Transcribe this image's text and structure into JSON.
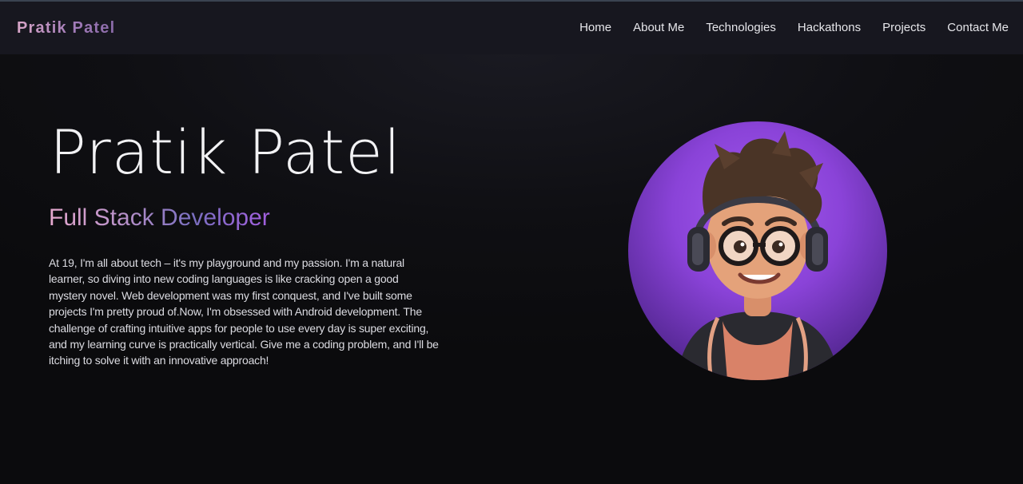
{
  "navbar": {
    "brand": "Pratik Patel",
    "links": [
      "Home",
      "About Me",
      "Technologies",
      "Hackathons",
      "Projects",
      "Contact Me"
    ]
  },
  "hero": {
    "name": "Pratik Patel",
    "role": "Full Stack Developer",
    "bio": "At 19, I'm all about tech – it's my playground and my passion. I'm a natural learner, so diving into new coding languages is like cracking open a good mystery novel. Web development was my first conquest, and I've built some projects I'm pretty proud of.Now, I'm obsessed with Android development. The challenge of crafting intuitive apps for people to use every day is super exciting, and my learning curve is practically vertical. Give me a coding problem, and I'll be itching to solve it with an innovative approach!",
    "avatar_icon": "cartoon-avatar-with-headphones"
  },
  "colors": {
    "background": "#0c0c0f",
    "navbar": "#17171f",
    "accent_purple": "#a259ee",
    "accent_pink": "#e6a9cf"
  }
}
